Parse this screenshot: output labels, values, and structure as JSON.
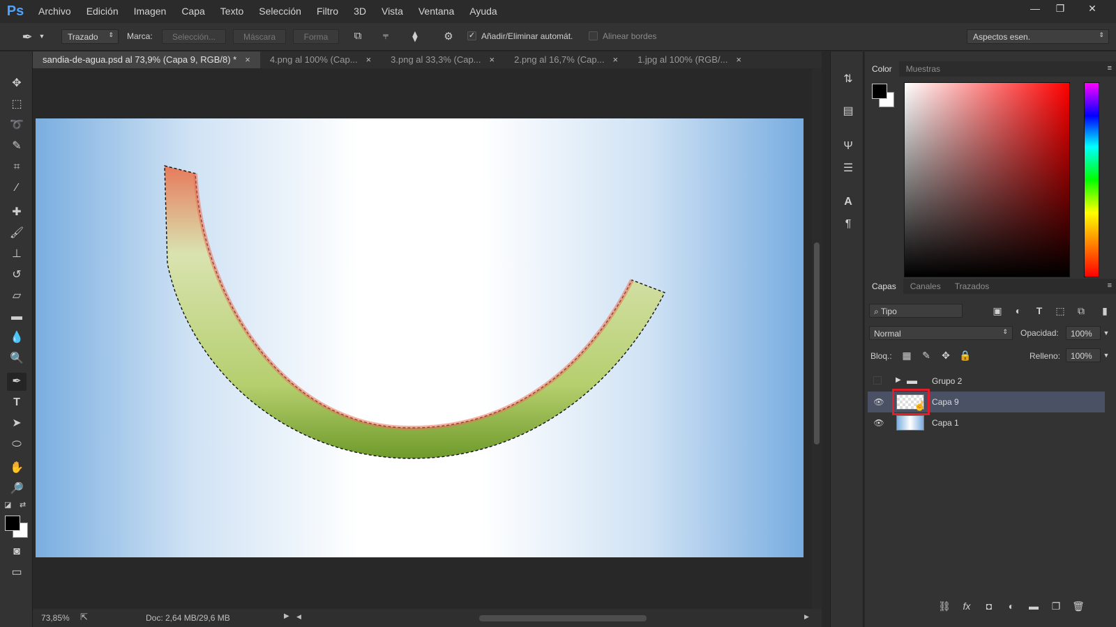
{
  "app": {
    "logo": "Ps"
  },
  "menu": [
    "Archivo",
    "Edición",
    "Imagen",
    "Capa",
    "Texto",
    "Selección",
    "Filtro",
    "3D",
    "Vista",
    "Ventana",
    "Ayuda"
  ],
  "window_buttons": {
    "minimize": "—",
    "restore": "❐",
    "close": "✕"
  },
  "options": {
    "mode_select": "Trazado",
    "marca_label": "Marca:",
    "seleccion_btn": "Selección...",
    "mascara_btn": "Máscara",
    "forma_btn": "Forma",
    "auto_add_label": "Añadir/Eliminar automát.",
    "auto_add_checked": "✓",
    "align_edges_label": "Alinear bordes",
    "workspace_select": "Aspectos esen."
  },
  "tabs": [
    {
      "label": "sandia-de-agua.psd al 73,9% (Capa 9, RGB/8) *",
      "close": "×"
    },
    {
      "label": "4.png al 100% (Cap...",
      "close": "×"
    },
    {
      "label": "3.png al 33,3% (Cap...",
      "close": "×"
    },
    {
      "label": "2.png al 16,7% (Cap...",
      "close": "×"
    },
    {
      "label": "1.jpg al 100% (RGB/...",
      "close": "×"
    }
  ],
  "status": {
    "zoom": "73,85%",
    "doc": "Doc: 2,64 MB/29,6 MB"
  },
  "color_panel": {
    "tabs": [
      "Color",
      "Muestras"
    ],
    "foreground": "#000000",
    "background": "#ffffff"
  },
  "layers_panel": {
    "tabs": [
      "Capas",
      "Canales",
      "Trazados"
    ],
    "filter_select": "Tipo",
    "blend_mode": "Normal",
    "opacity_label": "Opacidad:",
    "opacity_value": "100%",
    "lock_label": "Bloq.:",
    "fill_label": "Relleno:",
    "fill_value": "100%",
    "layers": [
      {
        "name": "Grupo 2",
        "type": "group",
        "visible": false
      },
      {
        "name": "Capa 9",
        "type": "pixel",
        "visible": true,
        "selected": true
      },
      {
        "name": "Capa 1",
        "type": "pixel",
        "visible": true
      }
    ]
  },
  "colors": {
    "accent_highlight": "#e01f2a",
    "selected_layer": "#4a5164",
    "ps_blue": "#4da3ff"
  }
}
